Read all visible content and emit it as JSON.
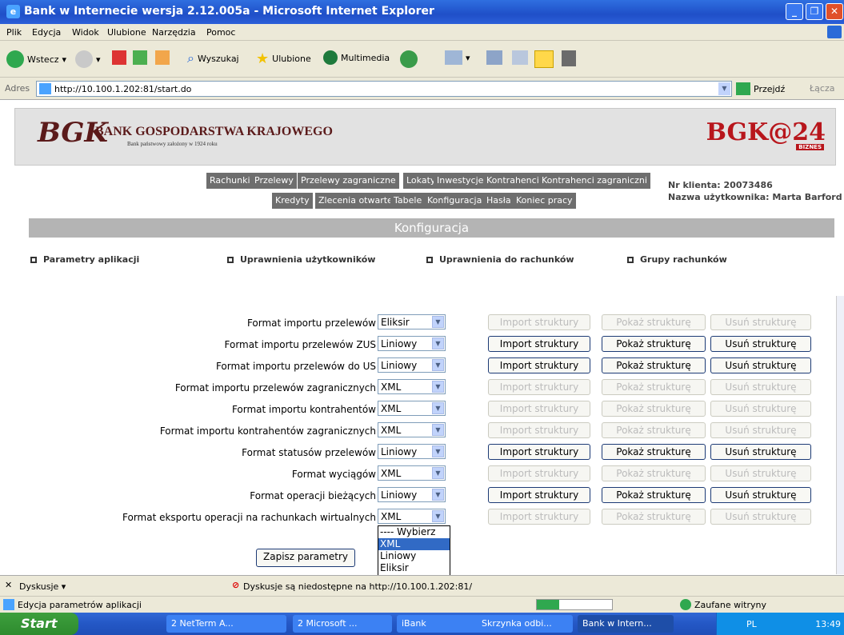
{
  "window": {
    "title": "Bank w Internecie wersja 2.12.005a - Microsoft Internet Explorer"
  },
  "menu": [
    "Plik",
    "Edycja",
    "Widok",
    "Ulubione",
    "Narzędzia",
    "Pomoc"
  ],
  "toolbar": {
    "back": "Wstecz",
    "search": "Wyszukaj",
    "favorites": "Ulubione",
    "media": "Multimedia"
  },
  "address": {
    "label": "Adres",
    "url": "http://10.100.1.202:81/start.do",
    "go": "Przejdź",
    "links": "Łącza"
  },
  "banner": {
    "monogram": "BGK",
    "name": "BANK GOSPODARSTWA KRAJOWEGO",
    "tagline": "Bank państwowy założony w 1924 roku",
    "brand": "BGK@24",
    "brand_sub": "BIZNES"
  },
  "nav": {
    "row1": [
      "Rachunki",
      "Przelewy",
      "Przelewy zagraniczne",
      "Lokaty",
      "Inwestycje",
      "Kontrahenci",
      "Kontrahenci zagraniczni"
    ],
    "row2": [
      "Kredyty",
      "Zlecenia otwarte",
      "Tabele",
      "Konfiguracja",
      "Hasła",
      "Koniec pracy"
    ]
  },
  "client": {
    "number": "Nr klienta: 20073486",
    "user": "Nazwa użytkownika: Marta Barford"
  },
  "section_title": "Konfiguracja",
  "tabs": [
    "Parametry aplikacji",
    "Uprawnienia użytkowników",
    "Uprawnienia do rachunków",
    "Grupy rachunków"
  ],
  "buttons": {
    "import": "Import struktury",
    "show": "Pokaż strukturę",
    "remove": "Usuń strukturę",
    "save": "Zapisz parametry"
  },
  "rows": [
    {
      "label": "Format importu przelewów",
      "value": "Eliksir",
      "enabled": false
    },
    {
      "label": "Format importu przelewów ZUS",
      "value": "Liniowy",
      "enabled": true
    },
    {
      "label": "Format importu przelewów do US",
      "value": "Liniowy",
      "enabled": true
    },
    {
      "label": "Format importu przelewów zagranicznych",
      "value": "XML",
      "enabled": false
    },
    {
      "label": "Format importu kontrahentów",
      "value": "XML",
      "enabled": false
    },
    {
      "label": "Format importu kontrahentów zagranicznych",
      "value": "XML",
      "enabled": false
    },
    {
      "label": "Format statusów przelewów",
      "value": "Liniowy",
      "enabled": true
    },
    {
      "label": "Format wyciągów",
      "value": "XML",
      "enabled": false
    },
    {
      "label": "Format operacji bieżących",
      "value": "Liniowy",
      "enabled": true
    },
    {
      "label": "Format eksportu operacji na rachunkach wirtualnych",
      "value": "XML",
      "enabled": false
    }
  ],
  "dropdown_options": [
    "---- Wybierz",
    "XML",
    "Liniowy",
    "Eliksir"
  ],
  "dropdown_selected": 1,
  "discuss": {
    "label": "Dyskusje",
    "message": "Dyskusje są niedostępne na http://10.100.1.202:81/"
  },
  "status": {
    "text": "Edycja parametrów aplikacji",
    "zone": "Zaufane witryny"
  },
  "taskbar": {
    "start": "Start",
    "tasks": [
      "2 NetTerm A...",
      "2 Microsoft ...",
      "iBank",
      "Skrzynka odbi...",
      "Bank w Intern..."
    ],
    "lang": "PL",
    "clock": "13:49"
  }
}
